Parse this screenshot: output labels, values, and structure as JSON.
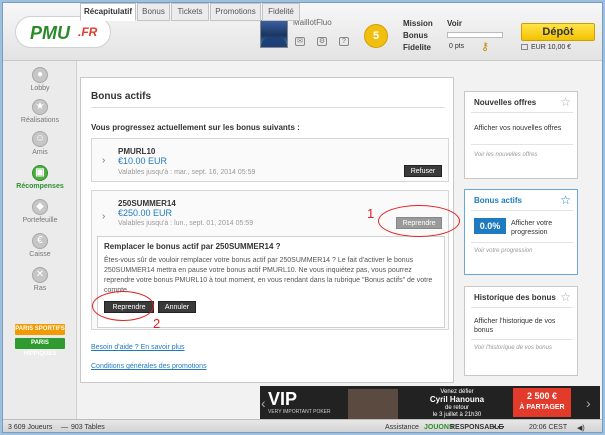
{
  "header": {
    "logo": "PMU",
    "logo_suffix": ".FR",
    "username": "MaillotFluo",
    "coin_count": "5",
    "mission_label": "Mission",
    "voir_label": "Voir",
    "bonus_label": "Bonus",
    "fidelite_label": "Fidelite",
    "points": "0 pts",
    "depot_label": "Dépôt",
    "balance": "EUR 10,00 €"
  },
  "sidebar": {
    "items": [
      {
        "label": "Lobby"
      },
      {
        "label": "Réalisations"
      },
      {
        "label": "Amis"
      },
      {
        "label": "Récompenses"
      },
      {
        "label": "Portefeuille"
      },
      {
        "label": "Caisse"
      },
      {
        "label": "Ras"
      }
    ],
    "paris_sportifs": "PARIS SPORTIFS",
    "paris_hippiques": "PARIS HIPPIQUES"
  },
  "tabs": [
    "Récapitulatif",
    "Bonus",
    "Tickets",
    "Promotions",
    "Fidelité"
  ],
  "main": {
    "title": "Bonus actifs",
    "intro": "Vous progressez actuellement sur les bonus suivants :",
    "bonuses": [
      {
        "name": "PMURL10",
        "amount": "€10.00 EUR",
        "date": "Valables jusqu'à : mar., sept. 16, 2014 05:59",
        "button": "Refuser"
      },
      {
        "name": "250SUMMER14",
        "amount": "€250.00 EUR",
        "date": "Valables jusqu'à : lun., sept. 01, 2014 05:59",
        "button": "Reprendre"
      }
    ],
    "confirm": {
      "title": "Remplacer le bonus actif par 250SUMMER14 ?",
      "text": "Êtes-vous sûr de vouloir remplacer votre bonus actif par 250SUMMER14 ? Le fait d'activer le bonus 250SUMMER14 mettra en pause votre bonus actif PMURL10. Ne vous inquiétez pas, vous pourrez reprendre votre bonus PMURL10 à tout moment, en vous rendant dans la rubrique \"Bonus actifs\" de votre compte.",
      "reprendre": "Reprendre",
      "annuler": "Annuler"
    },
    "help_link": "Besoin d'aide ? En savoir plus",
    "conditions_link": "Conditions générales des promotions"
  },
  "panels": {
    "offres": {
      "title": "Nouvelles offres",
      "text": "Afficher vos nouvelles offres",
      "link": "Voir les nouvelles offres"
    },
    "actifs": {
      "title": "Bonus actifs",
      "pct": "0.0%",
      "text": "Afficher votre progression",
      "link": "Voir votre progression"
    },
    "historique": {
      "title": "Historique des bonus",
      "text": "Afficher l'historique de vos bonus",
      "link": "Voir l'historique de vos bonus"
    }
  },
  "banner": {
    "vip": "VIP",
    "vip_sub": "VERY IMPORTANT POKER",
    "line1": "Venez défier",
    "line2": "Cyril Hanouna",
    "line3": "de retour",
    "line4": "le 3 juillet à 21h30",
    "prize": "2 500 €",
    "prize_sub": "À PARTAGER"
  },
  "status": {
    "players": "3 609 Joueurs",
    "tables": "903 Tables",
    "assistance": "Assistance",
    "jouons": "JOUONS",
    "responsable": "RESPONSABLE",
    "time": "20:06 CEST"
  },
  "annotations": {
    "one": "1",
    "two": "2"
  }
}
